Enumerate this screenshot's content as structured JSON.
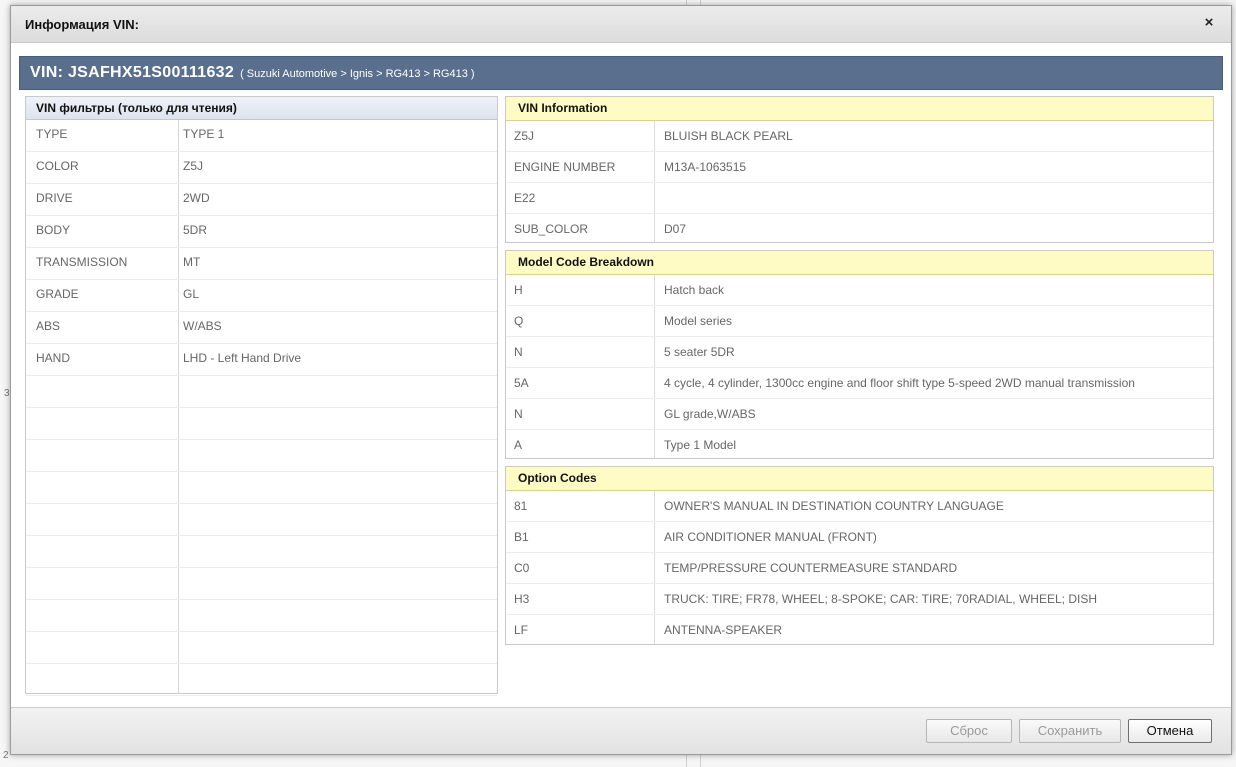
{
  "dialog": {
    "title": "Информация VIN:",
    "close_symbol": "×"
  },
  "vin": {
    "label": "VIN:",
    "code": "JSAFHX51S00111632",
    "path": "( Suzuki Automotive > Ignis > RG413 > RG413 )"
  },
  "filters": {
    "title": "VIN фильтры (только для чтения)",
    "rows": [
      {
        "key": "TYPE",
        "value": "TYPE 1"
      },
      {
        "key": "COLOR",
        "value": "Z5J"
      },
      {
        "key": "DRIVE",
        "value": "2WD"
      },
      {
        "key": "BODY",
        "value": "5DR"
      },
      {
        "key": "TRANSMISSION",
        "value": "MT"
      },
      {
        "key": "GRADE",
        "value": "GL"
      },
      {
        "key": "ABS",
        "value": "W/ABS"
      },
      {
        "key": "HAND",
        "value": "LHD -  Left Hand Drive"
      }
    ]
  },
  "vin_info": {
    "title": "VIN Information",
    "rows": [
      {
        "key": "Z5J",
        "value": "BLUISH BLACK PEARL"
      },
      {
        "key": "ENGINE NUMBER",
        "value": "M13A-1063515"
      },
      {
        "key": "E22",
        "value": ""
      },
      {
        "key": "SUB_COLOR",
        "value": "D07"
      }
    ]
  },
  "model_breakdown": {
    "title": "Model Code Breakdown",
    "rows": [
      {
        "key": "H",
        "value": "Hatch back"
      },
      {
        "key": "Q",
        "value": "Model series"
      },
      {
        "key": "N",
        "value": "5 seater 5DR"
      },
      {
        "key": "5A",
        "value": "4 cycle, 4 cylinder, 1300cc engine and floor shift type 5-speed 2WD manual transmission"
      },
      {
        "key": "N",
        "value": "GL grade,W/ABS"
      },
      {
        "key": "A",
        "value": "Type 1 Model"
      }
    ]
  },
  "option_codes": {
    "title": "Option Codes",
    "rows": [
      {
        "key": "81",
        "value": "OWNER'S MANUAL IN DESTINATION COUNTRY LANGUAGE"
      },
      {
        "key": "B1",
        "value": "AIR CONDITIONER MANUAL (FRONT)"
      },
      {
        "key": "C0",
        "value": "TEMP/PRESSURE COUNTERMEASURE STANDARD"
      },
      {
        "key": "H3",
        "value": "TRUCK: TIRE; FR78, WHEEL; 8-SPOKE; CAR: TIRE; 70RADIAL, WHEEL; DISH"
      },
      {
        "key": "LF",
        "value": "ANTENNA-SPEAKER"
      }
    ]
  },
  "footer": {
    "reset_label": "Сброс",
    "save_label": "Сохранить",
    "cancel_label": "Отмена"
  },
  "background": {
    "edge_numbers": [
      "3",
      "2"
    ]
  }
}
